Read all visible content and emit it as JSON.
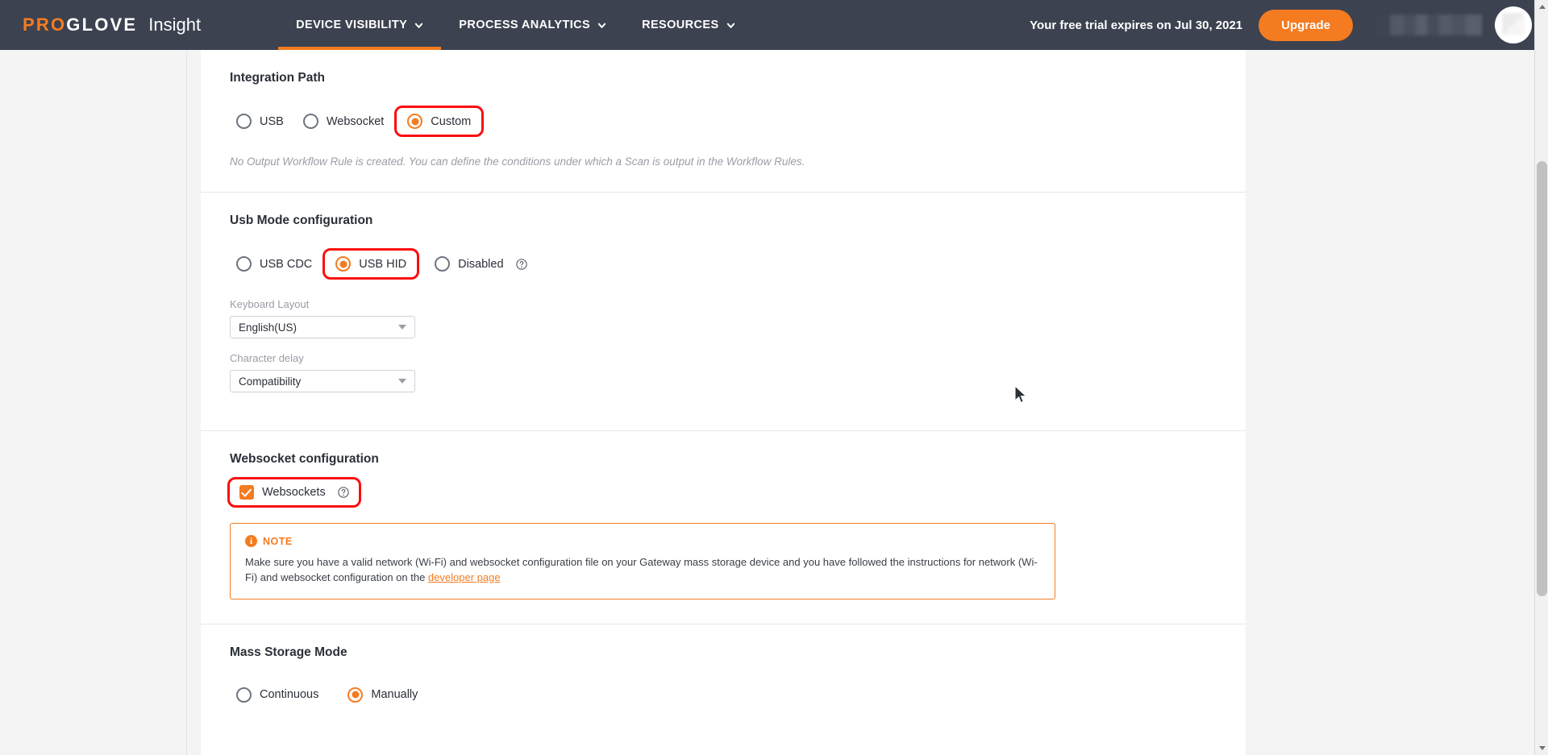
{
  "header": {
    "logo": {
      "part1": "PRO",
      "part2": "GLOVE",
      "product": "Insight"
    },
    "nav": [
      {
        "label": "DEVICE VISIBILITY",
        "icon": "chevron-down-icon",
        "active": true
      },
      {
        "label": "PROCESS ANALYTICS",
        "icon": "chevron-down-icon",
        "active": false
      },
      {
        "label": "RESOURCES",
        "icon": "chevron-down-icon",
        "active": false
      }
    ],
    "trial_notice": "Your free trial expires on Jul 30, 2021",
    "upgrade_label": "Upgrade",
    "accent_color": "#f47b20",
    "bar_color": "#3c4250"
  },
  "integration_path": {
    "title": "Integration Path",
    "options": [
      {
        "label": "USB",
        "selected": false,
        "highlighted": false
      },
      {
        "label": "Websocket",
        "selected": false,
        "highlighted": false
      },
      {
        "label": "Custom",
        "selected": true,
        "highlighted": true
      }
    ],
    "hint": "No Output Workflow Rule is created. You can define the conditions under which a Scan is output in the Workflow Rules."
  },
  "usb_mode": {
    "title": "Usb Mode configuration",
    "options": [
      {
        "label": "USB CDC",
        "selected": false,
        "highlighted": false
      },
      {
        "label": "USB HID",
        "selected": true,
        "highlighted": true
      },
      {
        "label": "Disabled",
        "selected": false,
        "highlighted": false,
        "help": true
      }
    ],
    "keyboard_layout_label": "Keyboard Layout",
    "keyboard_layout_value": "English(US)",
    "character_delay_label": "Character delay",
    "character_delay_value": "Compatibility"
  },
  "websocket": {
    "title": "Websocket configuration",
    "checkbox_label": "Websockets",
    "checkbox_checked": true,
    "note": {
      "icon": "info-icon",
      "title": "NOTE",
      "body_before": "Make sure you have a valid network (Wi-Fi) and websocket configuration file on your Gateway mass storage device and you have followed the instructions for network (Wi-Fi) and websocket configuration on the ",
      "link_text": "developer page",
      "border_color": "#f47b20"
    }
  },
  "mass_storage": {
    "title": "Mass Storage Mode",
    "options": [
      {
        "label": "Continuous",
        "selected": false
      },
      {
        "label": "Manually",
        "selected": true
      }
    ]
  }
}
